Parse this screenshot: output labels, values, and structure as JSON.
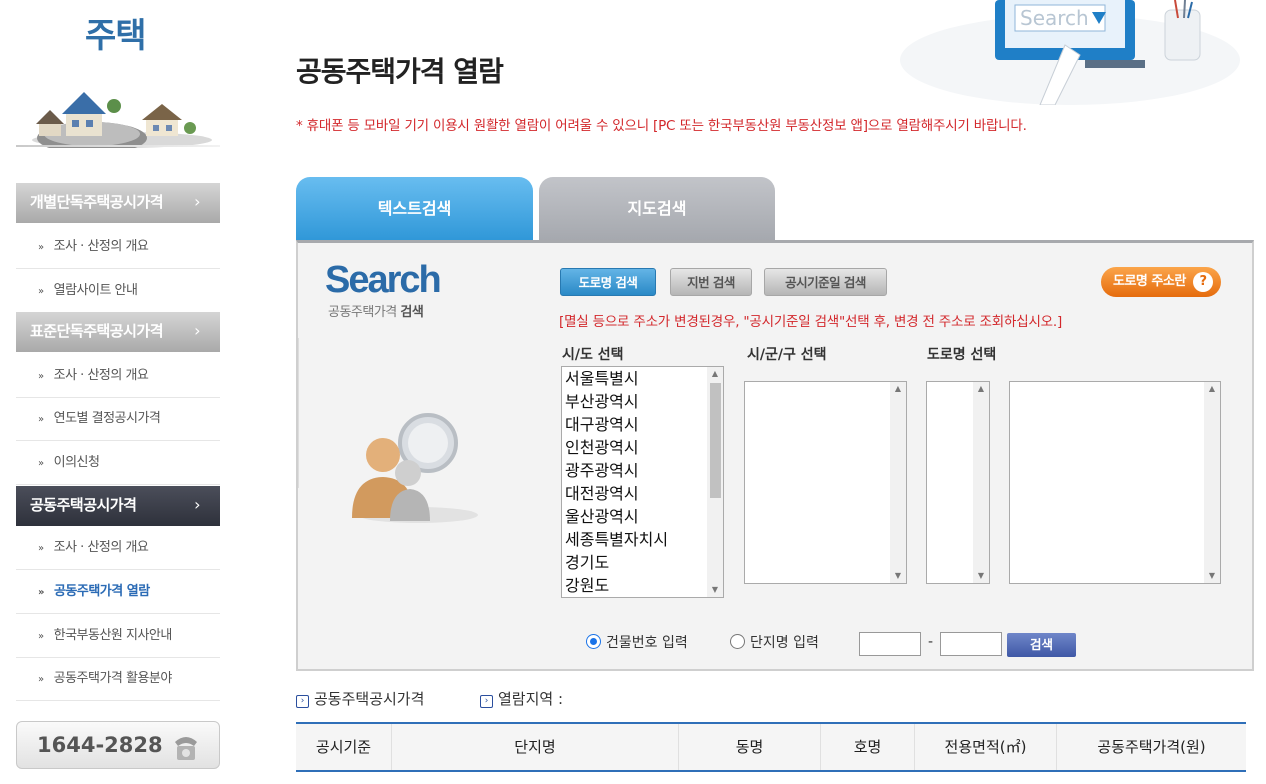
{
  "sidebar": {
    "title": "주택",
    "categories": [
      {
        "label": "개별단독주택공시가격",
        "chevron": "›"
      },
      {
        "label": "표준단독주택공시가격",
        "chevron": "›"
      },
      {
        "label": "공동주택공시가격",
        "chevron": "›"
      }
    ],
    "items": [
      {
        "label": "조사 · 산정의 개요"
      },
      {
        "label": "열람사이트 안내"
      },
      {
        "label": "조사 · 산정의 개요"
      },
      {
        "label": "연도별 결정공시가격"
      },
      {
        "label": "이의신청"
      },
      {
        "label": "조사 · 산정의 개요"
      },
      {
        "label": "공동주택가격 열람"
      },
      {
        "label": "한국부동산원 지사안내"
      },
      {
        "label": "공동주택가격 활용분야"
      }
    ],
    "bullet": "»",
    "phone": "1644-2828"
  },
  "header": {
    "title": "공동주택가격 열람",
    "notice": "* 휴대폰 등 모바일 기기 이용시 원활한 열람이 어려울 수 있으니 [PC 또는 한국부동산원 부동산정보 앱]으로 열람해주시기 바랍니다.",
    "art_text": "Search"
  },
  "tabs": [
    {
      "label": "텍스트검색",
      "active": true
    },
    {
      "label": "지도검색",
      "active": false
    }
  ],
  "panel": {
    "logo": "Search",
    "logo_sub": "공동주택가격",
    "logo_sub_bold": "검색",
    "buttons": {
      "road": "도로명 검색",
      "jibun": "지번 검색",
      "date": "공시기준일 검색",
      "help": "도로명 주소란",
      "help_icon": "?"
    },
    "warning": "[멸실 등으로 주소가 변경된경우, \"공시기준일 검색\"선택 후, 변경 전 주소로 조회하십시오.]",
    "labels": {
      "sido": "시/도 선택",
      "sigungu": "시/군/구 선택",
      "road": "도로명 선택"
    },
    "sido_options": [
      "서울특별시",
      "부산광역시",
      "대구광역시",
      "인천광역시",
      "광주광역시",
      "대전광역시",
      "울산광역시",
      "세종특별자치시",
      "경기도",
      "강원도"
    ],
    "radios": [
      {
        "label": "건물번호 입력",
        "checked": true
      },
      {
        "label": "단지명 입력",
        "checked": false
      }
    ],
    "dash": "-",
    "search_button": "검색"
  },
  "info": {
    "price_label": "공동주택공시가격",
    "region_label": "열람지역 :",
    "arrow": "›"
  },
  "table": {
    "headers": [
      "공시기준",
      "단지명",
      "동명",
      "호명",
      "전용면적(㎡)",
      "공동주택가격(원)"
    ]
  },
  "colors": {
    "accent_blue": "#2f97d8",
    "notice_red": "#d3282c",
    "help_orange": "#e56b0d",
    "search_blue": "#3f58a6"
  }
}
